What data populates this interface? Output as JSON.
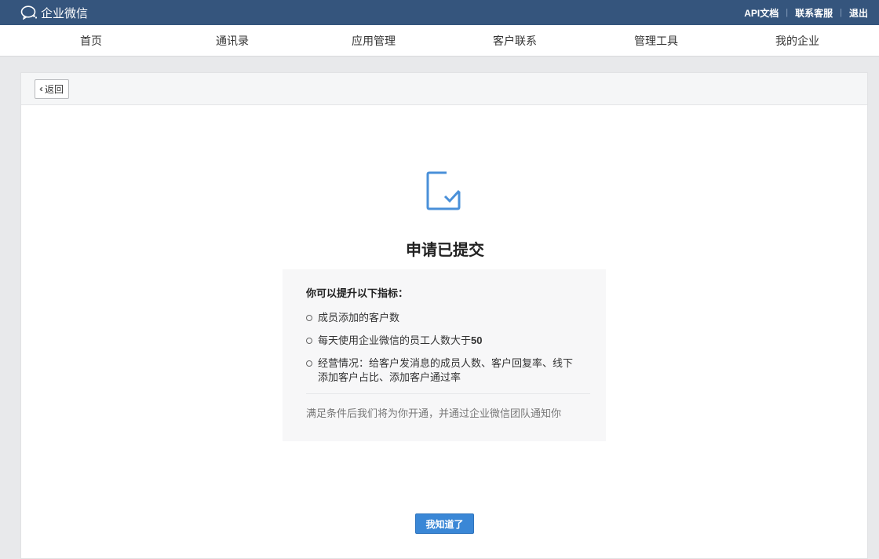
{
  "topbar": {
    "brand": "企业微信",
    "links": [
      "API文档",
      "联系客服",
      "退出"
    ]
  },
  "nav": {
    "items": [
      "首页",
      "通讯录",
      "应用管理",
      "客户联系",
      "管理工具",
      "我的企业"
    ]
  },
  "card": {
    "back_label": "返回",
    "title": "申请已提交",
    "info": {
      "heading": "你可以提升以下指标：",
      "items": [
        "成员添加的客户数",
        "每天使用企业微信的员工人数大于",
        "经营情况：给客户发消息的成员人数、客户回复率、线下添加客户占比、添加客户通过率"
      ],
      "item2_number": "50",
      "note": "满足条件后我们将为你开通，并通过企业微信团队通知你"
    },
    "confirm_label": "我知道了"
  },
  "colors": {
    "topbar": "#35557d",
    "primary_button": "#3a87d6",
    "check_icon": "#4a90d9"
  }
}
